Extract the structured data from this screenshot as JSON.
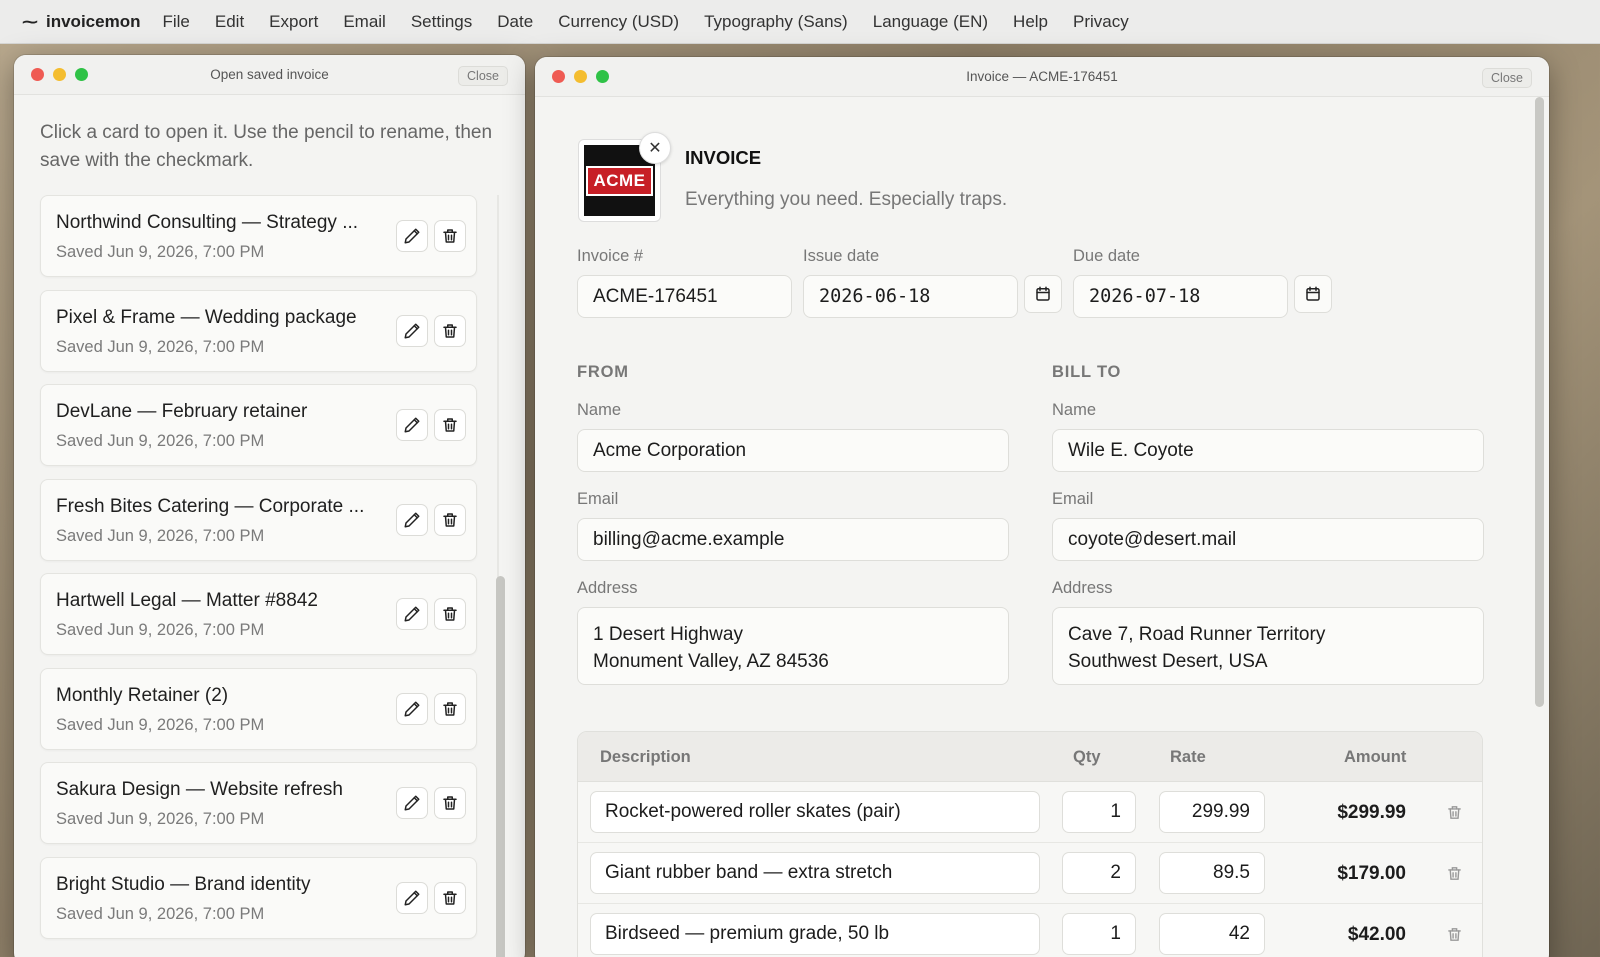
{
  "app": {
    "brand": "invoicemon",
    "menu": [
      "File",
      "Edit",
      "Export",
      "Email",
      "Settings",
      "Date",
      "Currency (USD)",
      "Typography (Sans)",
      "Language (EN)",
      "Help",
      "Privacy"
    ]
  },
  "left_window": {
    "title": "Open saved invoice",
    "close_label": "Close",
    "instructions": "Click a card to open it. Use the pencil to rename, then save with the checkmark.",
    "cards": [
      {
        "title": "Northwind Consulting — Strategy ...",
        "saved": "Saved Jun 9, 2026, 7:00 PM"
      },
      {
        "title": "Pixel & Frame — Wedding package",
        "saved": "Saved Jun 9, 2026, 7:00 PM"
      },
      {
        "title": "DevLane — February retainer",
        "saved": "Saved Jun 9, 2026, 7:00 PM"
      },
      {
        "title": "Fresh Bites Catering — Corporate ...",
        "saved": "Saved Jun 9, 2026, 7:00 PM"
      },
      {
        "title": "Hartwell Legal — Matter #8842",
        "saved": "Saved Jun 9, 2026, 7:00 PM"
      },
      {
        "title": "Monthly Retainer (2)",
        "saved": "Saved Jun 9, 2026, 7:00 PM"
      },
      {
        "title": "Sakura Design — Website refresh",
        "saved": "Saved Jun 9, 2026, 7:00 PM"
      },
      {
        "title": "Bright Studio — Brand identity",
        "saved": "Saved Jun 9, 2026, 7:00 PM"
      }
    ]
  },
  "right_window": {
    "title": "Invoice — ACME-176451",
    "close_label": "Close",
    "logo_text": "ACME",
    "heading": "INVOICE",
    "tagline": "Everything you need. Especially traps.",
    "invoice_number_label": "Invoice #",
    "invoice_number": "ACME-176451",
    "issue_date_label": "Issue date",
    "issue_date": "2026-06-18",
    "due_date_label": "Due date",
    "due_date": "2026-07-18",
    "from": {
      "section": "FROM",
      "name_label": "Name",
      "name": "Acme Corporation",
      "email_label": "Email",
      "email": "billing@acme.example",
      "address_label": "Address",
      "address_line1": "1 Desert Highway",
      "address_line2": "Monument Valley, AZ 84536"
    },
    "bill_to": {
      "section": "BILL TO",
      "name_label": "Name",
      "name": "Wile E. Coyote",
      "email_label": "Email",
      "email": "coyote@desert.mail",
      "address_label": "Address",
      "address_line1": "Cave 7, Road Runner Territory",
      "address_line2": "Southwest Desert, USA"
    },
    "table": {
      "headers": {
        "description": "Description",
        "qty": "Qty",
        "rate": "Rate",
        "amount": "Amount"
      },
      "rows": [
        {
          "description": "Rocket-powered roller skates (pair)",
          "qty": "1",
          "rate": "299.99",
          "amount": "$299.99"
        },
        {
          "description": "Giant rubber band — extra stretch",
          "qty": "2",
          "rate": "89.5",
          "amount": "$179.00"
        },
        {
          "description": "Birdseed — premium grade, 50 lb",
          "qty": "1",
          "rate": "42",
          "amount": "$42.00"
        }
      ]
    }
  }
}
